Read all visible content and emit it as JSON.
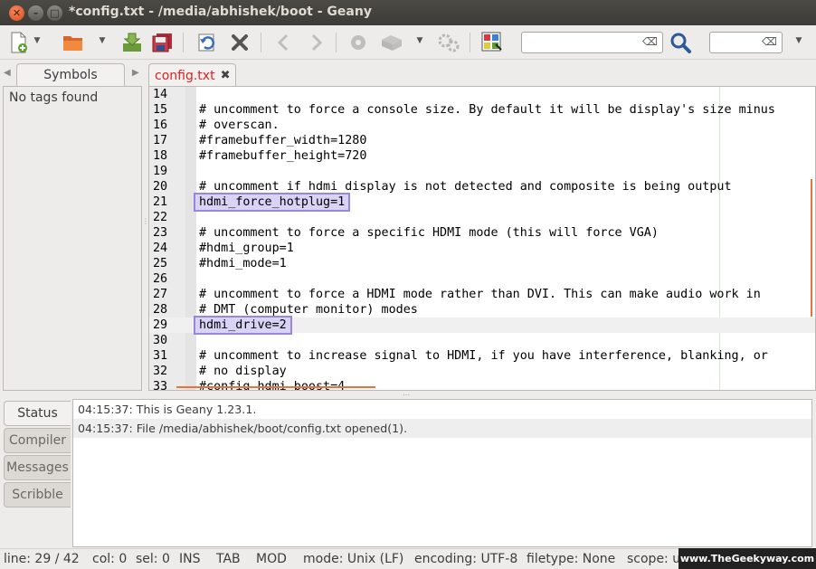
{
  "window": {
    "title": "*config.txt - /media/abhishek/boot - Geany",
    "close_glyph": "✕",
    "min_glyph": "–",
    "max_glyph": "□"
  },
  "toolbar": {
    "icons": [
      "new-file-icon",
      "open-file-icon",
      "save-icon",
      "save-all-icon",
      "revert-icon",
      "close-file-icon",
      "back-icon",
      "forward-icon",
      "compile-icon",
      "build-icon",
      "execute-icon",
      "color-chooser-icon",
      "find-icon"
    ],
    "search_value": "",
    "goto_value": ""
  },
  "sidebar": {
    "tab_label": "Symbols",
    "empty_text": "No tags found"
  },
  "editor": {
    "tab_label": "config.txt",
    "tab_close": "✖",
    "lines": [
      {
        "num": "14",
        "text": ""
      },
      {
        "num": "15",
        "text": "# uncomment to force a console size. By default it will be display's size minus"
      },
      {
        "num": "16",
        "text": "# overscan."
      },
      {
        "num": "17",
        "text": "#framebuffer_width=1280"
      },
      {
        "num": "18",
        "text": "#framebuffer_height=720"
      },
      {
        "num": "19",
        "text": ""
      },
      {
        "num": "20",
        "text": "# uncomment if hdmi display is not detected and composite is being output"
      },
      {
        "num": "21",
        "text": "hdmi_force_hotplug=1"
      },
      {
        "num": "22",
        "text": ""
      },
      {
        "num": "23",
        "text": "# uncomment to force a specific HDMI mode (this will force VGA)"
      },
      {
        "num": "24",
        "text": "#hdmi_group=1"
      },
      {
        "num": "25",
        "text": "#hdmi_mode=1"
      },
      {
        "num": "26",
        "text": ""
      },
      {
        "num": "27",
        "text": "# uncomment to force a HDMI mode rather than DVI. This can make audio work in"
      },
      {
        "num": "28",
        "text": "# DMT (computer monitor) modes"
      },
      {
        "num": "29",
        "text": "hdmi_drive=2"
      },
      {
        "num": "30",
        "text": ""
      },
      {
        "num": "31",
        "text": "# uncomment to increase signal to HDMI, if you have interference, blanking, or"
      },
      {
        "num": "32",
        "text": "# no display"
      },
      {
        "num": "33",
        "text": "#config_hdmi_boost=4"
      }
    ]
  },
  "bottom": {
    "tabs": [
      "Status",
      "Compiler",
      "Messages",
      "Scribble"
    ],
    "messages": [
      "04:15:37: This is Geany 1.23.1.",
      "04:15:37: File /media/abhishek/boot/config.txt opened(1)."
    ]
  },
  "statusbar": {
    "line": "line: 29 / 42",
    "col": "col: 0",
    "sel": "sel: 0",
    "ins": "INS",
    "tab": "TAB",
    "mod": "MOD",
    "mode": "mode: Unix (LF)",
    "encoding": "encoding: UTF-8",
    "filetype": "filetype: None",
    "scope": "scope: u"
  },
  "watermark": "www.TheGeekyway.com"
}
